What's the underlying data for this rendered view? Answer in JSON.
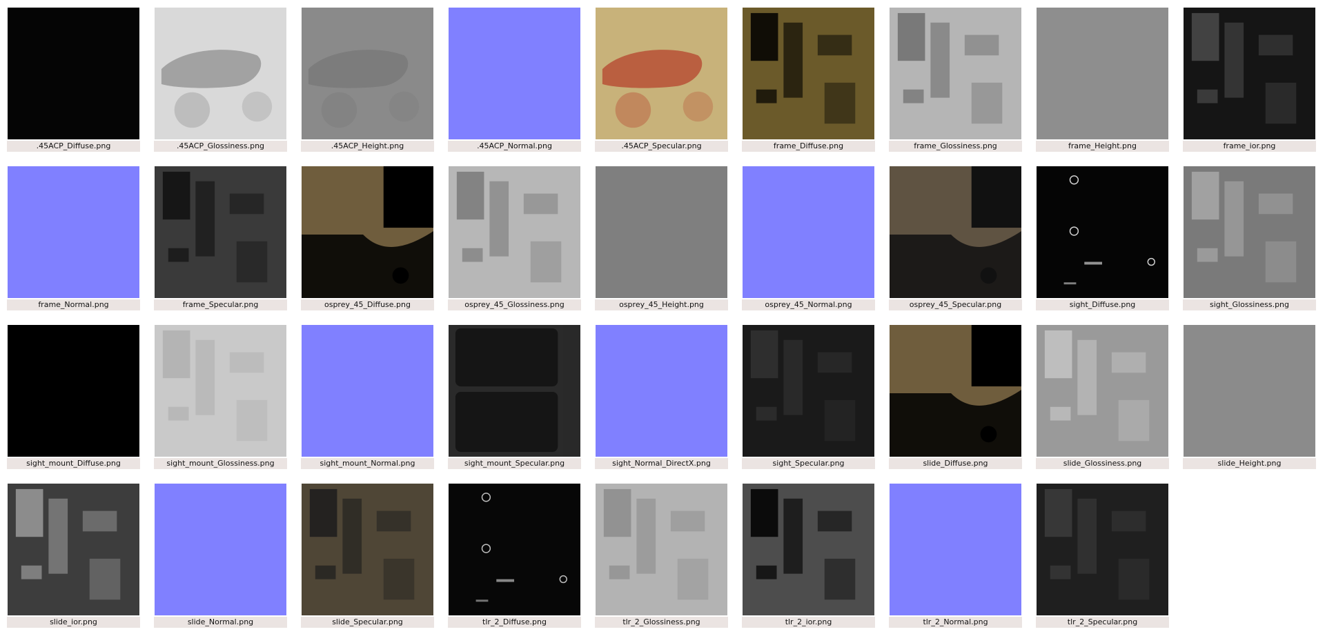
{
  "files": [
    {
      "name": ".45ACP_Diffuse.png",
      "color": "#050505",
      "style": "solid"
    },
    {
      "name": ".45ACP_Glossiness.png",
      "color": "#d9d9d9",
      "style": "blob",
      "accent": "#9b9b9b"
    },
    {
      "name": ".45ACP_Height.png",
      "color": "#8a8a8a",
      "style": "blob",
      "accent": "#7a7a7a"
    },
    {
      "name": ".45ACP_Normal.png",
      "color": "#8080ff",
      "style": "solid"
    },
    {
      "name": ".45ACP_Specular.png",
      "color": "#c8b27a",
      "style": "blob",
      "accent": "#b8553a"
    },
    {
      "name": "frame_Diffuse.png",
      "color": "#6b5a2a",
      "style": "patches",
      "accent": "#000000"
    },
    {
      "name": "frame_Glossiness.png",
      "color": "#b5b5b5",
      "style": "patches",
      "accent": "#6e6e6e"
    },
    {
      "name": "frame_Height.png",
      "color": "#8e8e8e",
      "style": "solid"
    },
    {
      "name": "frame_ior.png",
      "color": "#151515",
      "style": "patches",
      "accent": "#4a4a4a"
    },
    {
      "name": "frame_Normal.png",
      "color": "#8080ff",
      "style": "solid"
    },
    {
      "name": "frame_Specular.png",
      "color": "#3a3a3a",
      "style": "patches",
      "accent": "#111111"
    },
    {
      "name": "osprey_45_Diffuse.png",
      "color": "#6f5d3d",
      "style": "split",
      "accent": "#000000"
    },
    {
      "name": "osprey_45_Glossiness.png",
      "color": "#b7b7b7",
      "style": "patches",
      "accent": "#7a7a7a"
    },
    {
      "name": "osprey_45_Height.png",
      "color": "#7f7f7f",
      "style": "solid"
    },
    {
      "name": "osprey_45_Normal.png",
      "color": "#8080ff",
      "style": "solid"
    },
    {
      "name": "osprey_45_Specular.png",
      "color": "#5f5342",
      "style": "split",
      "accent": "#111111"
    },
    {
      "name": "sight_Diffuse.png",
      "color": "#050505",
      "style": "dots",
      "accent": "#d0d0d0"
    },
    {
      "name": "sight_Glossiness.png",
      "color": "#7a7a7a",
      "style": "patches",
      "accent": "#a8a8a8"
    },
    {
      "name": "sight_mount_Diffuse.png",
      "color": "#000000",
      "style": "solid"
    },
    {
      "name": "sight_mount_Glossiness.png",
      "color": "#c9c9c9",
      "style": "patches",
      "accent": "#b0b0b0"
    },
    {
      "name": "sight_mount_Normal.png",
      "color": "#8080ff",
      "style": "solid"
    },
    {
      "name": "sight_mount_Specular.png",
      "color": "#2a2a2a",
      "style": "panels",
      "accent": "#151515"
    },
    {
      "name": "sight_Normal_DirectX.png",
      "color": "#8080ff",
      "style": "solid"
    },
    {
      "name": "sight_Specular.png",
      "color": "#1a1a1a",
      "style": "patches",
      "accent": "#333333"
    },
    {
      "name": "slide_Diffuse.png",
      "color": "#6f5d3d",
      "style": "split",
      "accent": "#000000"
    },
    {
      "name": "slide_Glossiness.png",
      "color": "#9a9a9a",
      "style": "patches",
      "accent": "#c4c4c4"
    },
    {
      "name": "slide_Height.png",
      "color": "#8b8b8b",
      "style": "solid"
    },
    {
      "name": "slide_ior.png",
      "color": "#3d3d3d",
      "style": "patches",
      "accent": "#9a9a9a"
    },
    {
      "name": "slide_Normal.png",
      "color": "#8080ff",
      "style": "solid"
    },
    {
      "name": "slide_Specular.png",
      "color": "#4f4636",
      "style": "patches",
      "accent": "#1c1c1c"
    },
    {
      "name": "tlr_2_Diffuse.png",
      "color": "#070707",
      "style": "dots",
      "accent": "#bdbdbd"
    },
    {
      "name": "tlr_2_Glossiness.png",
      "color": "#b3b3b3",
      "style": "patches",
      "accent": "#8c8c8c"
    },
    {
      "name": "tlr_2_ior.png",
      "color": "#4d4d4d",
      "style": "patches",
      "accent": "#000000"
    },
    {
      "name": "tlr_2_Normal.png",
      "color": "#8080ff",
      "style": "solid"
    },
    {
      "name": "tlr_2_Specular.png",
      "color": "#1f1f1f",
      "style": "patches",
      "accent": "#3c3c3c"
    }
  ]
}
